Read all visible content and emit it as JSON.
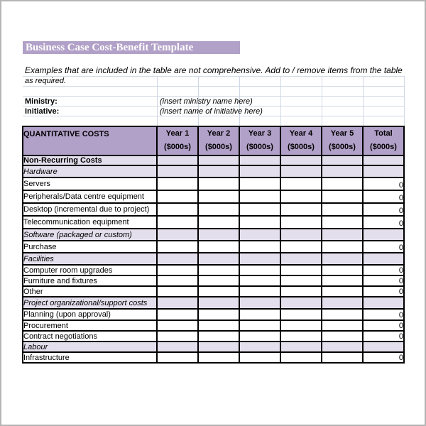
{
  "document": {
    "title": "Business Case Cost-Benefit Template",
    "instructions_line1": "Examples that are included in the table are not comprehensive.  Add to / remove items from the table",
    "instructions_line2": "as required.",
    "fields": [
      {
        "label": "Ministry:",
        "value": "(insert ministry name here)"
      },
      {
        "label": "Initiative:",
        "value": "(insert name of initiative here)"
      }
    ]
  },
  "colors": {
    "header_bg": "#b1a0c7",
    "subheader_bg": "#e4dfec",
    "gridline": "#d0d7e5"
  },
  "table": {
    "header": {
      "first": "QUANTITATIVE COSTS",
      "columns": [
        {
          "line1": "Year 1",
          "line2": "($000s)"
        },
        {
          "line1": "Year 2",
          "line2": "($000s)"
        },
        {
          "line1": "Year 3",
          "line2": "($000s)"
        },
        {
          "line1": "Year 4",
          "line2": "($000s)"
        },
        {
          "line1": "Year 5",
          "line2": "($000s)"
        },
        {
          "line1": "Total",
          "line2": "($000s)"
        }
      ]
    },
    "rows": [
      {
        "label": "Non-Recurring Costs",
        "type": "section",
        "total": ""
      },
      {
        "label": "Hardware",
        "type": "sub",
        "total": ""
      },
      {
        "label": "Servers",
        "type": "item",
        "total": "0"
      },
      {
        "label": "Peripherals/Data centre equipment",
        "type": "item",
        "total": "0"
      },
      {
        "label": "Desktop (incremental due to project)",
        "type": "item",
        "total": "0"
      },
      {
        "label": "Telecommunication equipment",
        "type": "item",
        "total": "0"
      },
      {
        "label": "Software (packaged or custom)",
        "type": "sub",
        "total": ""
      },
      {
        "label": "Purchase",
        "type": "item",
        "total": "0"
      },
      {
        "label": "Facilities",
        "type": "sub",
        "total": ""
      },
      {
        "label": "Computer room upgrades",
        "type": "item",
        "total": "0"
      },
      {
        "label": "Furniture and fixtures",
        "type": "item",
        "total": "0"
      },
      {
        "label": "Other",
        "type": "item",
        "total": "0"
      },
      {
        "label": "Project organizational/support costs",
        "type": "sub",
        "total": ""
      },
      {
        "label": "Planning (upon approval)",
        "type": "item",
        "total": "0"
      },
      {
        "label": "Procurement",
        "type": "item",
        "total": "0"
      },
      {
        "label": "Contract negotiations",
        "type": "item",
        "total": "0"
      },
      {
        "label": "Labour",
        "type": "sub",
        "total": ""
      },
      {
        "label": "Infrastructure",
        "type": "item",
        "total": "0"
      }
    ]
  }
}
